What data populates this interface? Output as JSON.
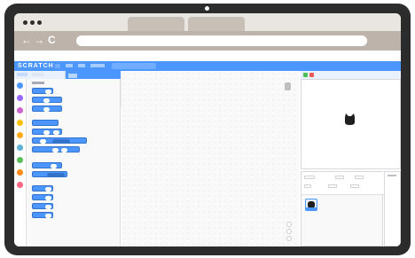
{
  "browser": {
    "nav_glyphs": [
      "←",
      "→",
      "C"
    ]
  },
  "colors": {
    "device_frame": "#2c2c2c",
    "scratch_blue": "#4c97ff",
    "green_flag": "#4cbf56",
    "stop": "#ec5959"
  },
  "icons": [
    "back-arrow-icon",
    "forward-arrow-icon",
    "reload-icon",
    "green-flag-icon",
    "stop-icon",
    "cat-sprite-icon"
  ],
  "app": {
    "logo": "SCRATCH"
  }
}
